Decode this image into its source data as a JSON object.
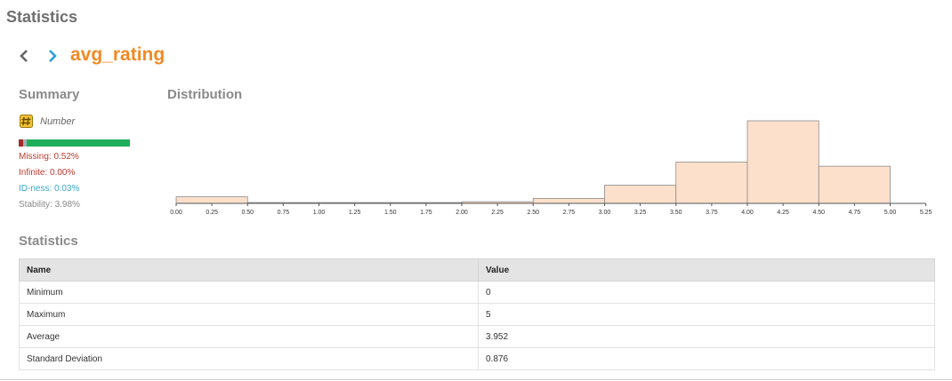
{
  "page": {
    "title": "Statistics"
  },
  "navigation": {
    "back_icon": "chevron-left",
    "forward_icon": "chevron-right"
  },
  "attribute": {
    "name": "avg_rating"
  },
  "summary": {
    "heading": "Summary",
    "type_icon": "number-hash-icon",
    "type_label": "Number",
    "quality_bar": {
      "missing_fraction": 0.0052,
      "idness_fraction": 0.0003
    },
    "missing": "Missing: 0.52%",
    "infinite": "Infinite: 0.00%",
    "idness": "ID-ness: 0.03%",
    "stability": "Stability: 3.98%"
  },
  "distribution": {
    "heading": "Distribution"
  },
  "statistics": {
    "heading": "Statistics",
    "columns": [
      "Name",
      "Value"
    ],
    "rows": [
      {
        "name": "Minimum",
        "value": "0"
      },
      {
        "name": "Maximum",
        "value": "5"
      },
      {
        "name": "Average",
        "value": "3.952"
      },
      {
        "name": "Standard Deviation",
        "value": "0.876"
      }
    ]
  },
  "colors": {
    "accent": "#f08a24",
    "missing": "#c0392b",
    "idness": "#3aa7c9",
    "ok": "#1fae5a",
    "bar_fill": "#fde0cc"
  },
  "chart_data": {
    "type": "bar",
    "bins": [
      {
        "from": 0.0,
        "to": 0.5,
        "count": 0.8
      },
      {
        "from": 0.5,
        "to": 1.0,
        "count": 0.1
      },
      {
        "from": 1.0,
        "to": 1.5,
        "count": 0.1
      },
      {
        "from": 1.5,
        "to": 2.0,
        "count": 0.1
      },
      {
        "from": 2.0,
        "to": 2.5,
        "count": 0.2
      },
      {
        "from": 2.5,
        "to": 3.0,
        "count": 0.6
      },
      {
        "from": 3.0,
        "to": 3.5,
        "count": 2.2
      },
      {
        "from": 3.5,
        "to": 4.0,
        "count": 5.0
      },
      {
        "from": 4.0,
        "to": 4.5,
        "count": 10.0
      },
      {
        "from": 4.5,
        "to": 5.0,
        "count": 4.5
      }
    ],
    "x_ticks": [
      "0.00",
      "0.25",
      "0.50",
      "0.75",
      "1.00",
      "1.25",
      "1.50",
      "1.75",
      "2.00",
      "2.25",
      "2.50",
      "2.75",
      "3.00",
      "3.25",
      "3.50",
      "3.75",
      "4.00",
      "4.25",
      "4.50",
      "4.75",
      "5.00",
      "5.25"
    ],
    "xlim": [
      0,
      5.25
    ],
    "ylim": [
      0,
      10
    ],
    "grid": false,
    "legend": "none"
  }
}
